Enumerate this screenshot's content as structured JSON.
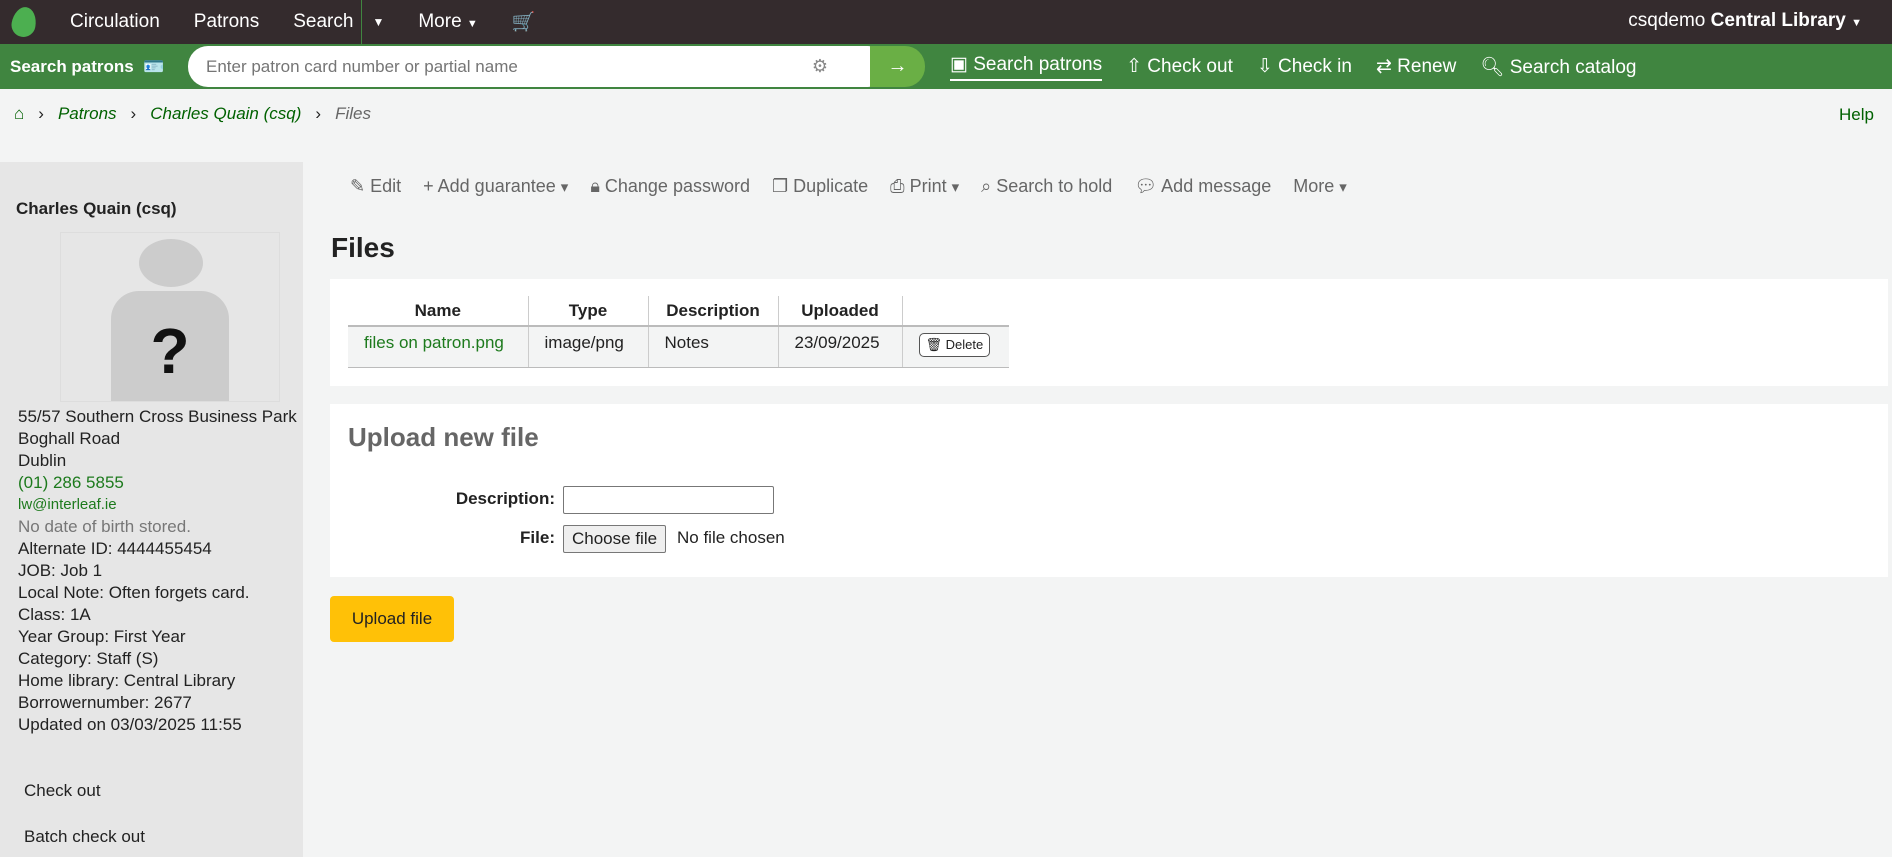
{
  "topnav": {
    "items": [
      "Circulation",
      "Patrons",
      "Search",
      "More"
    ],
    "user": "csqdemo",
    "library": "Central Library"
  },
  "searchbar": {
    "label": "Search patrons",
    "placeholder": "Enter patron card number or partial name",
    "links": [
      "Search patrons",
      "Check out",
      "Check in",
      "Renew",
      "Search catalog"
    ]
  },
  "breadcrumb": [
    "Patrons",
    "Charles Quain (csq)",
    "Files"
  ],
  "help": "Help",
  "patron": {
    "name": "Charles Quain (csq)",
    "info": [
      "55/57 Southern Cross Business Park",
      "Boghall Road",
      "Dublin"
    ],
    "phone": "(01) 286 5855",
    "email": "lw@interleaf.ie",
    "dob": "No date of birth stored.",
    "details": [
      "Alternate ID: 4444455454",
      "JOB: Job 1",
      "Local Note: Often forgets card.",
      "Class: 1A",
      "Year Group: First Year",
      "Category: Staff (S)",
      "Home library: Central Library",
      "Borrowernumber: 2677",
      "Updated on 03/03/2025 11:55"
    ],
    "links": [
      "Check out",
      "Batch check out"
    ],
    "photo_placeholder": "?"
  },
  "toolbar": [
    "Edit",
    "Add guarantee",
    "Change password",
    "Duplicate",
    "Print",
    "Search to hold",
    "Add message",
    "More"
  ],
  "title": "Files",
  "files": {
    "headers": [
      "Name",
      "Type",
      "Description",
      "Uploaded",
      ""
    ],
    "rows": [
      {
        "name": "files on patron.png",
        "type": "image/png",
        "description": "Notes",
        "uploaded": "23/09/2025",
        "action": "Delete"
      }
    ]
  },
  "upload": {
    "title": "Upload new file",
    "desc_label": "Description:",
    "file_label": "File:",
    "choose": "Choose file",
    "nofile": "No file chosen",
    "button": "Upload file"
  }
}
